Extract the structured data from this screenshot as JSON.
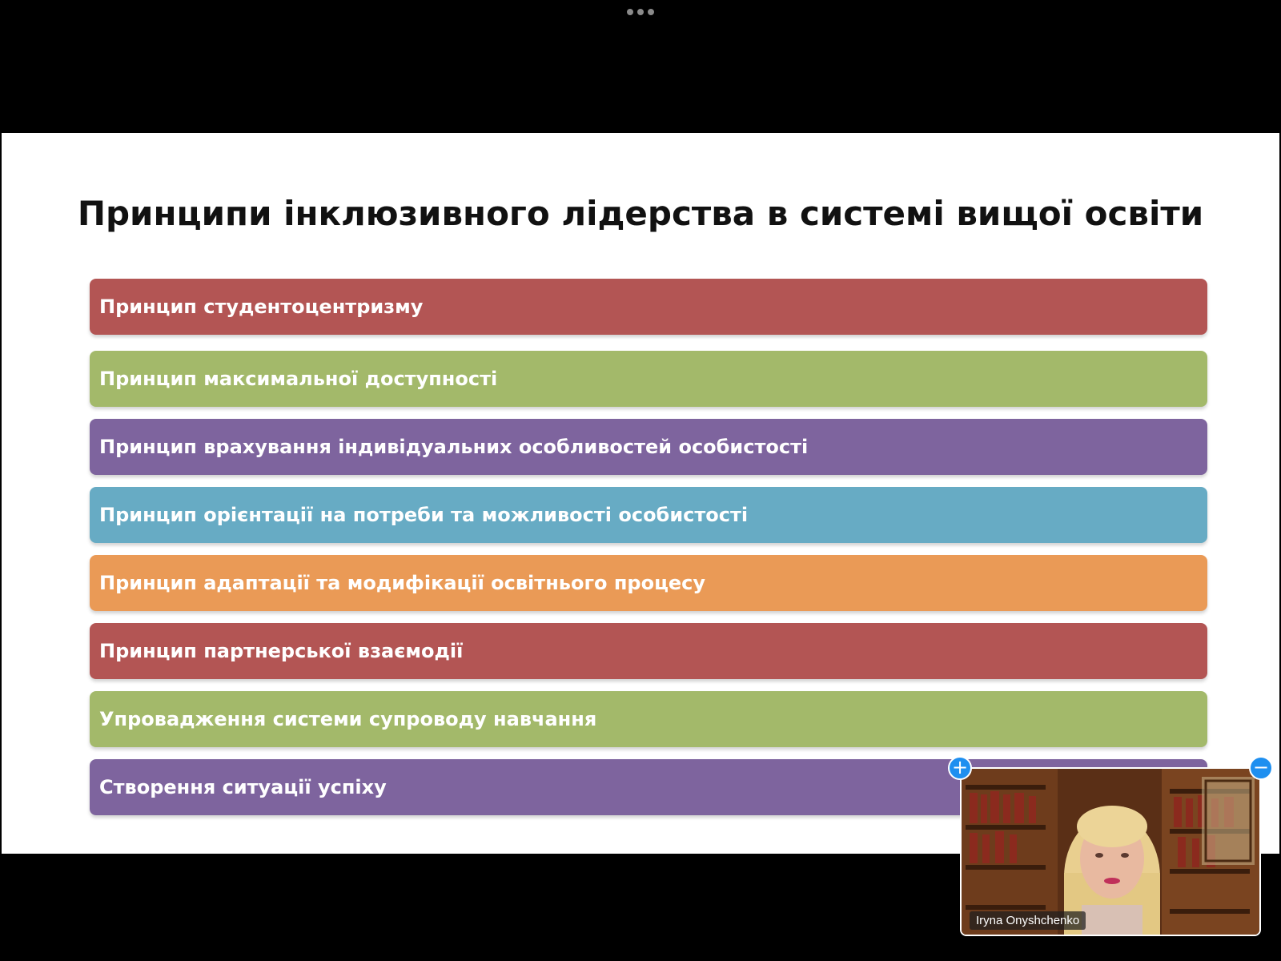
{
  "slide": {
    "title": "Принципи інклюзивного лідерства в системі вищої освіти",
    "items": [
      {
        "label": "Принцип студентоцентризму",
        "color": "#b35554"
      },
      {
        "label": "Принцип максимальної доступності",
        "color": "#a3b96a"
      },
      {
        "label": "Принцип врахування індивідуальних особливостей особистості",
        "color": "#7e649e"
      },
      {
        "label": "Принцип орієнтації на потреби та можливості особистості",
        "color": "#67abc4"
      },
      {
        "label": "Принцип адаптації та модифікації освітнього процесу",
        "color": "#ea9a56"
      },
      {
        "label": "Принцип партнерської взаємодії",
        "color": "#b35554"
      },
      {
        "label": "Упровадження системи супроводу навчання",
        "color": "#a3b96a"
      },
      {
        "label": "Створення ситуації успіху",
        "color": "#7e649e"
      }
    ]
  },
  "video": {
    "participant_name": "Iryna Onyshchenko",
    "enlarge_icon": "plus-icon",
    "shrink_icon": "minus-icon",
    "accent_color": "#1e8ff0"
  },
  "toolbar": {
    "more_icon": "more-horizontal-icon"
  }
}
